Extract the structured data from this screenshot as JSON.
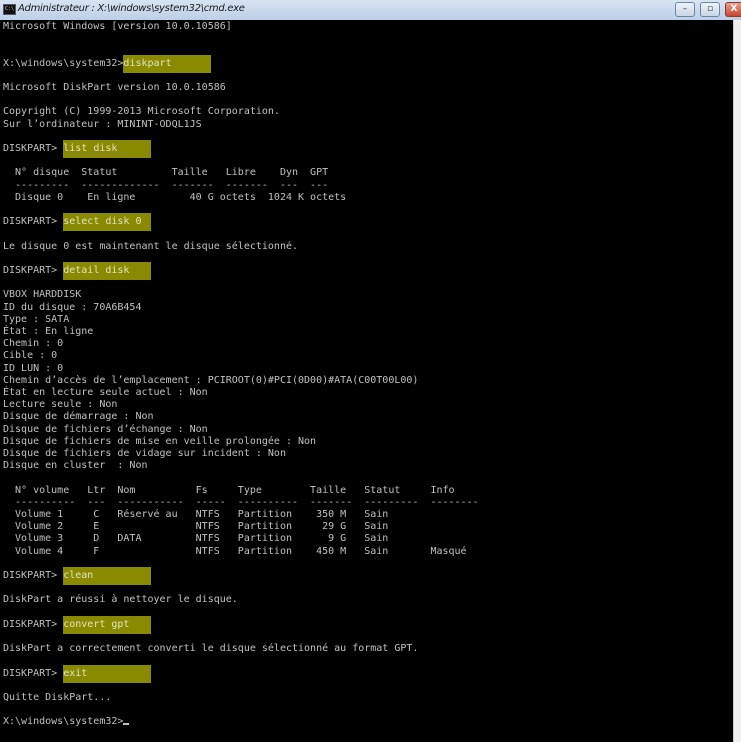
{
  "window": {
    "title": "Administrateur : X:\\windows\\system32\\cmd.exe",
    "minimize": "–",
    "maximize": "▫",
    "close": "X"
  },
  "colors": {
    "highlight": "#8a8a00",
    "text": "#c0c0c0",
    "background": "#000000"
  },
  "lines": [
    {
      "text": "Microsoft Windows [version 10.0.10586]"
    },
    {
      "text": ""
    },
    {
      "text": ""
    },
    {
      "text": "X:\\windows\\system32>",
      "cmd": "diskpart"
    },
    {
      "text": ""
    },
    {
      "text": "Microsoft DiskPart version 10.0.10586"
    },
    {
      "text": ""
    },
    {
      "text": "Copyright (C) 1999-2013 Microsoft Corporation."
    },
    {
      "text": "Sur l’ordinateur : MININT-ODQL1JS"
    },
    {
      "text": ""
    },
    {
      "text": "DISKPART> ",
      "cmd": "list disk"
    },
    {
      "text": ""
    },
    {
      "text": "  N° disque  Statut         Taille   Libre    Dyn  GPT"
    },
    {
      "text": "  ---------  -------------  -------  -------  ---  ---"
    },
    {
      "text": "  Disque 0    En ligne         40 G octets  1024 K octets"
    },
    {
      "text": ""
    },
    {
      "text": "DISKPART> ",
      "cmd": "select disk 0"
    },
    {
      "text": ""
    },
    {
      "text": "Le disque 0 est maintenant le disque sélectionné."
    },
    {
      "text": ""
    },
    {
      "text": "DISKPART> ",
      "cmd": "detail disk"
    },
    {
      "text": ""
    },
    {
      "text": "VBOX HARDDISK"
    },
    {
      "text": "ID du disque : 70A6B454"
    },
    {
      "text": "Type : SATA"
    },
    {
      "text": "État : En ligne"
    },
    {
      "text": "Chemin : 0"
    },
    {
      "text": "Cible : 0"
    },
    {
      "text": "ID LUN : 0"
    },
    {
      "text": "Chemin d’accès de l’emplacement : PCIROOT(0)#PCI(0D00)#ATA(C00T00L00)"
    },
    {
      "text": "État en lecture seule actuel : Non"
    },
    {
      "text": "Lecture seule : Non"
    },
    {
      "text": "Disque de démarrage : Non"
    },
    {
      "text": "Disque de fichiers d’échange : Non"
    },
    {
      "text": "Disque de fichiers de mise en veille prolongée : Non"
    },
    {
      "text": "Disque de fichiers de vidage sur incident : Non"
    },
    {
      "text": "Disque en cluster  : Non"
    },
    {
      "text": ""
    },
    {
      "text": "  N° volume   Ltr  Nom          Fs     Type        Taille   Statut     Info"
    },
    {
      "text": "  ----------  ---  -----------  -----  ----------  -------  ---------  --------"
    },
    {
      "text": "  Volume 1     C   Réservé au   NTFS   Partition    350 M   Sain"
    },
    {
      "text": "  Volume 2     E                NTFS   Partition     29 G   Sain"
    },
    {
      "text": "  Volume 3     D   DATA         NTFS   Partition      9 G   Sain"
    },
    {
      "text": "  Volume 4     F                NTFS   Partition    450 M   Sain       Masqué"
    },
    {
      "text": ""
    },
    {
      "text": "DISKPART> ",
      "cmd": "clean"
    },
    {
      "text": ""
    },
    {
      "text": "DiskPart a réussi à nettoyer le disque."
    },
    {
      "text": ""
    },
    {
      "text": "DISKPART> ",
      "cmd": "convert gpt"
    },
    {
      "text": ""
    },
    {
      "text": "DiskPart a correctement converti le disque sélectionné au format GPT."
    },
    {
      "text": ""
    },
    {
      "text": "DISKPART> ",
      "cmd": "exit"
    },
    {
      "text": ""
    },
    {
      "text": "Quitte DiskPart..."
    },
    {
      "text": ""
    },
    {
      "text": "X:\\windows\\system32>",
      "cursor": true
    }
  ]
}
